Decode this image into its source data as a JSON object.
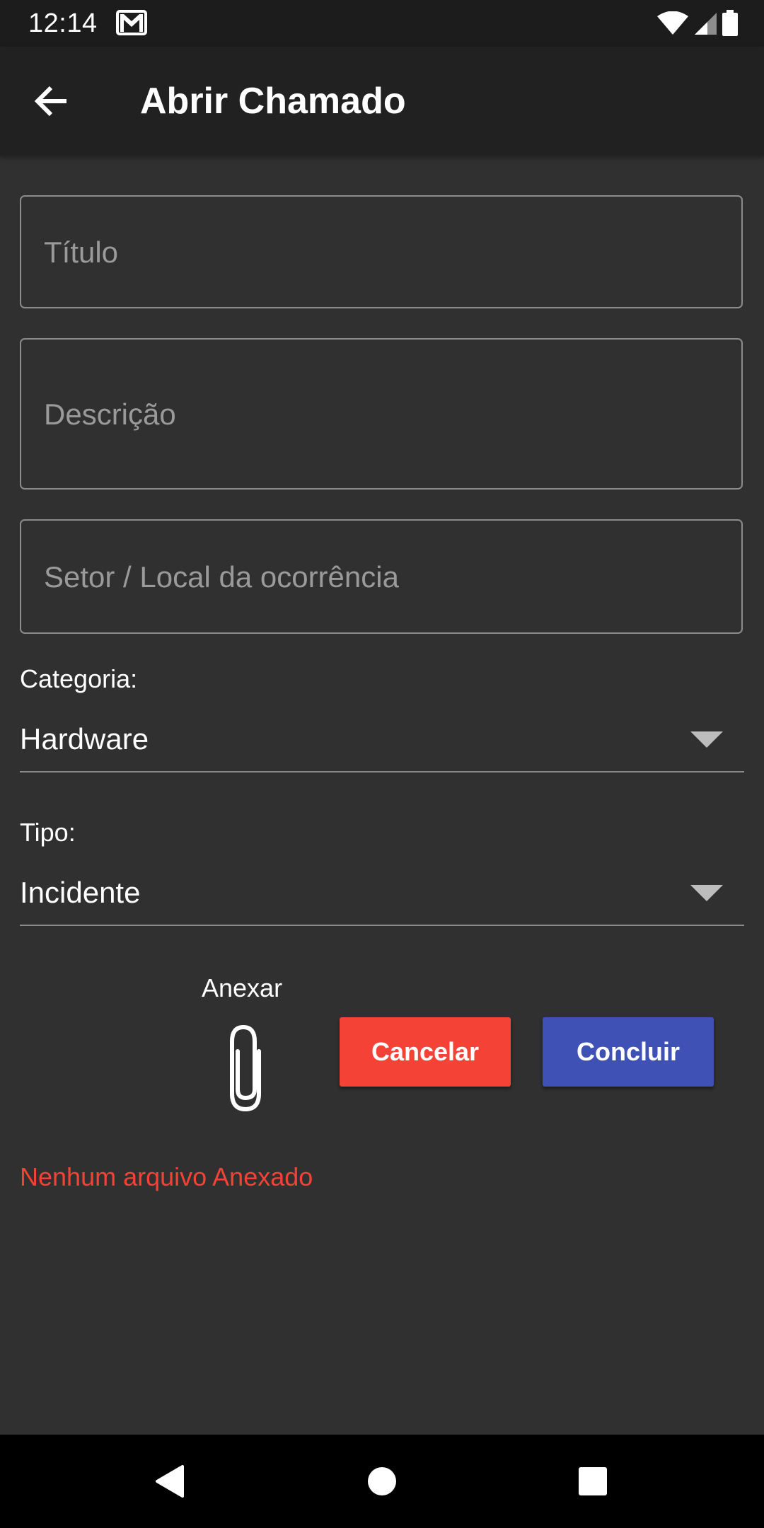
{
  "status_bar": {
    "time": "12:14",
    "icons": [
      "gmail-icon",
      "wifi-icon",
      "signal-icon",
      "battery-icon"
    ]
  },
  "app_bar": {
    "title": "Abrir Chamado",
    "back_icon": "arrow-back-icon"
  },
  "form": {
    "title_placeholder": "Título",
    "description_placeholder": "Descrição",
    "location_placeholder": "Setor / Local da ocorrência",
    "category_label": "Categoria:",
    "category_value": "Hardware",
    "type_label": "Tipo:",
    "type_value": "Incidente",
    "attach_label": "Anexar",
    "attach_icon": "paperclip-icon",
    "cancel_label": "Cancelar",
    "done_label": "Concluir",
    "attachment_status": "Nenhum arquivo Anexado"
  },
  "colors": {
    "background": "#303030",
    "app_bar": "#212121",
    "cancel_button": "#f44336",
    "done_button": "#3f51b5",
    "error_text": "#f44336"
  },
  "nav_bar": {
    "icons": [
      "back-triangle-icon",
      "home-circle-icon",
      "recents-square-icon"
    ]
  }
}
